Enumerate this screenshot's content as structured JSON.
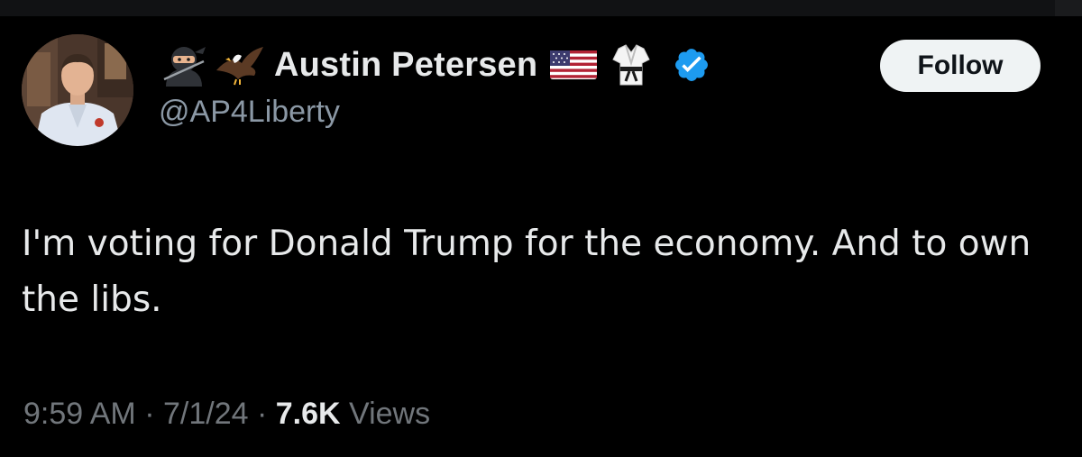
{
  "author": {
    "display_name": "Austin Petersen",
    "handle": "@AP4Liberty",
    "name_icons_before": [
      "ninja-icon",
      "eagle-icon"
    ],
    "name_icons_after": [
      "us-flag-icon",
      "martial-arts-uniform-icon",
      "verified-badge-icon"
    ],
    "verified_color": "#1d9bf0"
  },
  "follow_button": {
    "label": "Follow"
  },
  "tweet": {
    "text": "I'm voting for Donald Trump for the economy. And to own the libs."
  },
  "meta": {
    "time": "9:59 AM",
    "separator": "·",
    "date": "7/1/24",
    "views_count": "7.6K",
    "views_label": "Views"
  },
  "colors": {
    "background": "#000000",
    "primary_text": "#e7e9ea",
    "secondary_text": "#71767b",
    "button_bg": "#eff3f4"
  }
}
